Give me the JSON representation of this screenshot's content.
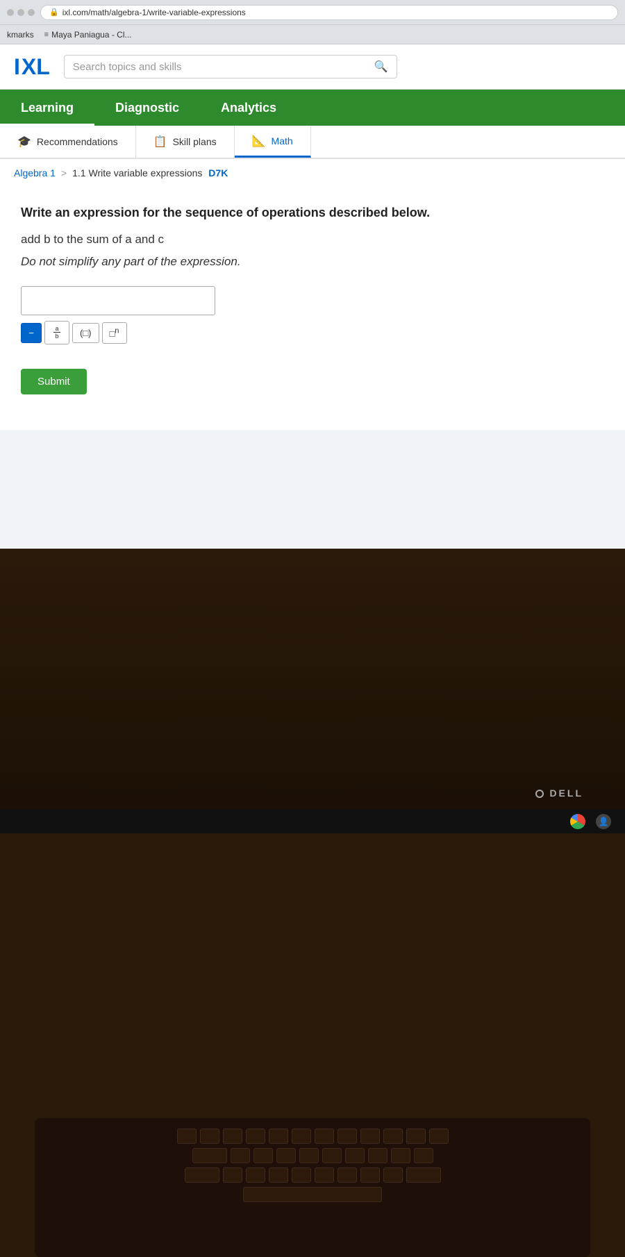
{
  "browser": {
    "url": "ixl.com/math/algebra-1/write-variable-expressions",
    "bookmark1": "kmarks",
    "bookmark2": "Maya Paniagua - Cl..."
  },
  "header": {
    "logo": "IXL",
    "search_placeholder": "Search topics and skills"
  },
  "nav": {
    "items": [
      {
        "label": "Learning",
        "active": true
      },
      {
        "label": "Diagnostic",
        "active": false
      },
      {
        "label": "Analytics",
        "active": false
      }
    ]
  },
  "subnav": {
    "items": [
      {
        "label": "Recommendations",
        "icon": "🎓",
        "active": false
      },
      {
        "label": "Skill plans",
        "icon": "📋",
        "active": false
      },
      {
        "label": "Math",
        "icon": "📐",
        "active": true
      }
    ]
  },
  "breadcrumb": {
    "parent": "Algebra 1",
    "separator": ">",
    "current": "1.1 Write variable expressions",
    "code": "D7K"
  },
  "question": {
    "prompt": "Write an expression for the sequence of operations described below.",
    "body": "add b to the sum of a and c",
    "instruction": "Do not simplify any part of the expression."
  },
  "toolbar": {
    "fraction_label": "a/b",
    "parens_label": "(□)",
    "exponent_label": "□ⁿ",
    "submit_label": "Submit"
  },
  "taskbar": {
    "dell_label": "DELL"
  }
}
